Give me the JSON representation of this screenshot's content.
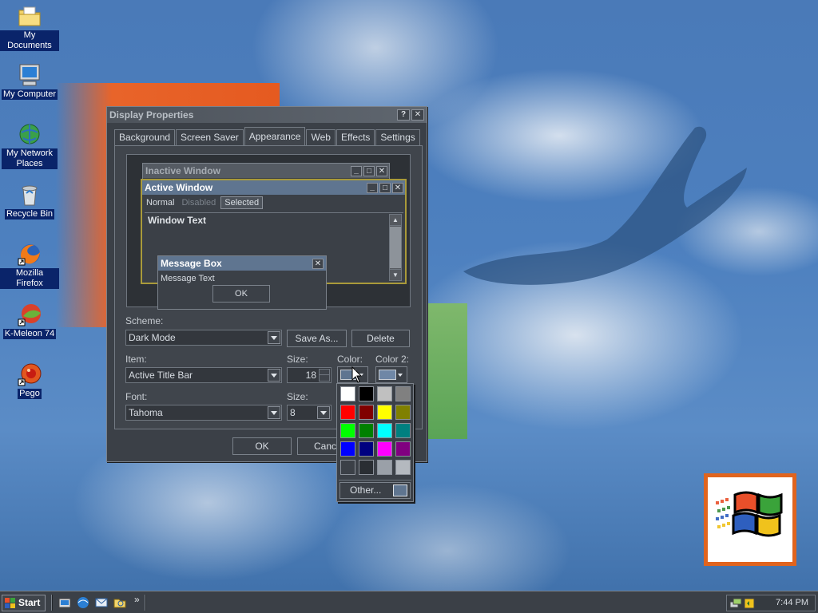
{
  "desktop": {
    "icons": [
      {
        "label": "My Documents"
      },
      {
        "label": "My Computer"
      },
      {
        "label": "My Network Places"
      },
      {
        "label": "Recycle Bin"
      },
      {
        "label": "Mozilla Firefox"
      },
      {
        "label": "K-Meleon 74"
      },
      {
        "label": "Pego"
      }
    ]
  },
  "dialog": {
    "title": "Display Properties",
    "help_btn": "?",
    "close_btn": "✕",
    "tabs": [
      "Background",
      "Screen Saver",
      "Appearance",
      "Web",
      "Effects",
      "Settings"
    ],
    "preview": {
      "inactive_title": "Inactive Window",
      "active_title": "Active Window",
      "menu": [
        "Normal",
        "Disabled",
        "Selected"
      ],
      "window_text": "Window Text",
      "msgbox_title": "Message Box",
      "msgbox_text": "Message Text",
      "ok": "OK"
    },
    "scheme_label": "Scheme:",
    "scheme_value": "Dark Mode",
    "save_as": "Save As...",
    "delete": "Delete",
    "item_label": "Item:",
    "item_value": "Active Title Bar",
    "size_label": "Size:",
    "size_value": "18",
    "color_label": "Color:",
    "color2_label": "Color 2:",
    "font_label": "Font:",
    "font_value": "Tahoma",
    "font_size_label": "Size:",
    "font_size_value": "8",
    "ok": "OK",
    "cancel": "Cance"
  },
  "color_popup": {
    "swatches": [
      "#ffffff",
      "#000000",
      "#c0c0c0",
      "#808080",
      "#ff0000",
      "#800000",
      "#ffff00",
      "#808000",
      "#00ff00",
      "#008000",
      "#00ffff",
      "#008080",
      "#0000ff",
      "#000080",
      "#ff00ff",
      "#800080",
      "#3b4047",
      "#2a2e33",
      "#9aa0a8",
      "#b4b9bf"
    ],
    "other": "Other..."
  },
  "taskbar": {
    "start": "Start",
    "chevron": "»",
    "clock": "7:44 PM"
  },
  "colors": {
    "selected_color": "#5f7590",
    "color2": "#6f87a6"
  }
}
